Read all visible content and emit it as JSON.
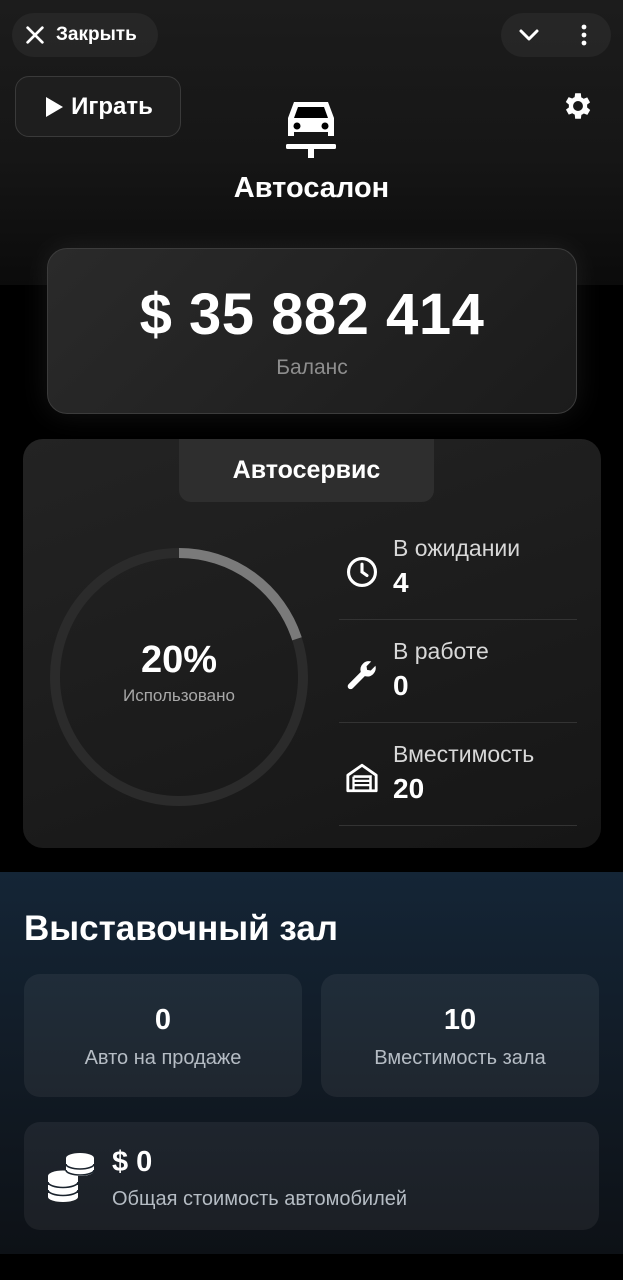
{
  "header": {
    "close_label": "Закрыть",
    "close_icon": "close-icon",
    "collapse_icon": "chevron-down-icon",
    "more_icon": "more-vertical-icon"
  },
  "toolbar": {
    "play_label": "Играть",
    "settings_icon": "gear-icon"
  },
  "app": {
    "title": "Автосалон",
    "icon": "car-lift-icon"
  },
  "balance": {
    "value": "$ 35 882 414",
    "label": "Баланс"
  },
  "service": {
    "title": "Автосервис",
    "usage_percent": "20%",
    "usage_fraction": 0.2,
    "usage_label": "Использовано",
    "stats": [
      {
        "label": "В ожидании",
        "value": "4",
        "icon": "clock-icon"
      },
      {
        "label": "В работе",
        "value": "0",
        "icon": "wrench-icon"
      },
      {
        "label": "Вместимость",
        "value": "20",
        "icon": "garage-icon"
      }
    ]
  },
  "showroom": {
    "title": "Выставочный зал",
    "cards": [
      {
        "value": "0",
        "label": "Авто на продаже"
      },
      {
        "value": "10",
        "label": "Вместимость зала"
      }
    ],
    "total": {
      "value": "$ 0",
      "label": "Общая стоимость автомобилей",
      "icon": "coins-icon"
    }
  },
  "colors": {
    "background": "#000000",
    "ring_track": "#2b2b2b",
    "ring_fill": "#7a7a7a",
    "showroom_bg": "#142536"
  }
}
